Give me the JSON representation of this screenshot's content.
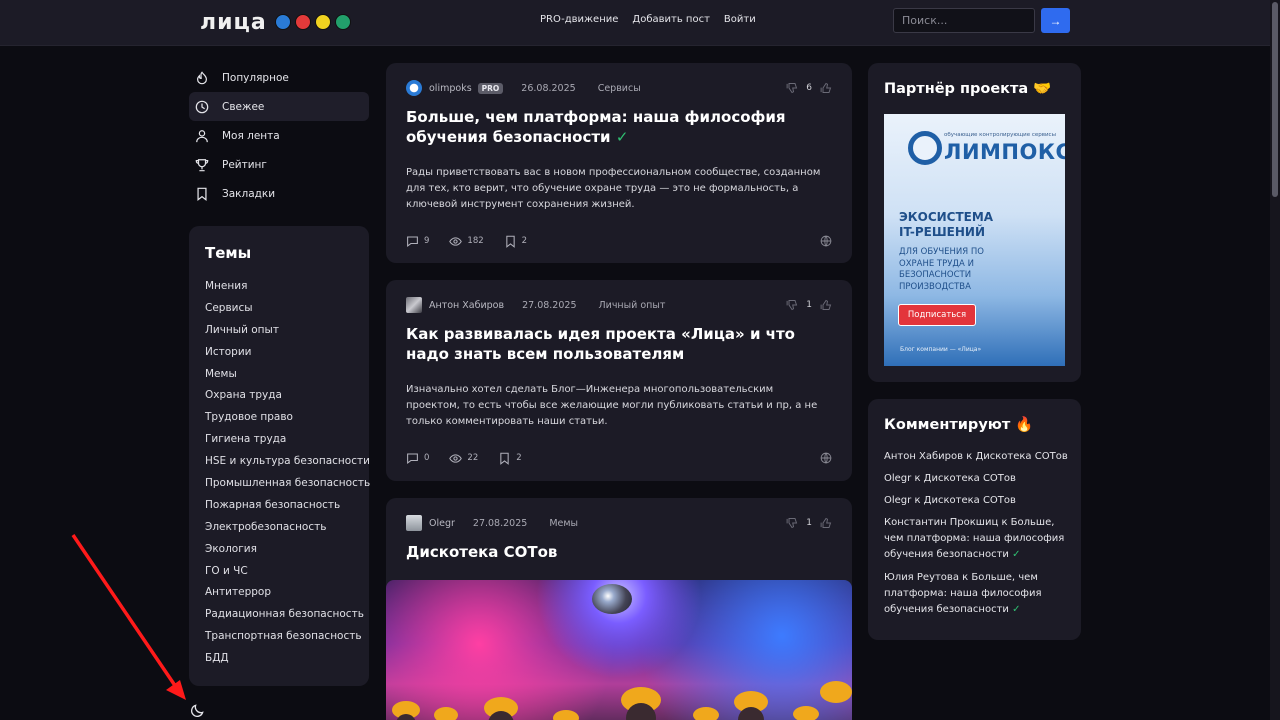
{
  "header": {
    "logo": "лица",
    "nav": [
      "PRO-движение",
      "Добавить пост",
      "Войти"
    ],
    "search_placeholder": "Поиск...",
    "search_button": "→"
  },
  "menu": [
    {
      "label": "Популярное",
      "icon": "fire-icon"
    },
    {
      "label": "Свежее",
      "icon": "clock-icon"
    },
    {
      "label": "Моя лента",
      "icon": "user-icon"
    },
    {
      "label": "Рейтинг",
      "icon": "trophy-icon"
    },
    {
      "label": "Закладки",
      "icon": "bookmark-icon"
    }
  ],
  "topics": {
    "title": "Темы",
    "items": [
      "Мнения",
      "Сервисы",
      "Личный опыт",
      "Истории",
      "Мемы",
      "Охрана труда",
      "Трудовое право",
      "Гигиена труда",
      "HSE и культура безопасности",
      "Промышленная безопасность",
      "Пожарная безопасность",
      "Электробезопасность",
      "Экология",
      "ГО и ЧС",
      "Антитеррор",
      "Радиационная безопасность",
      "Транспортная безопасность",
      "БДД"
    ]
  },
  "posts": [
    {
      "author": "olimpoks",
      "badge": "PRO",
      "date": "26.08.2025",
      "category": "Сервисы",
      "votes": "6",
      "title": "Больше, чем платформа: наша философия обучения безопасности",
      "verified": "✓",
      "text": "Рады приветствовать вас в новом профессиональном сообществе, созданном для тех, кто верит, что обучение охране труда — это не формальность, а ключевой инструмент сохранения жизней.",
      "comments": "9",
      "views": "182",
      "bookmarks": "2"
    },
    {
      "author": "Антон Хабиров",
      "date": "27.08.2025",
      "category": "Личный опыт",
      "votes": "1",
      "title": "Как развивалась идея проекта «Лица» и что надо знать всем пользователям",
      "text": "Изначально хотел сделать Блог—Инженера многопользовательским проектом, то есть чтобы все желающие могли публиковать статьи и пр, а не только комментировать наши статьи.",
      "comments": "0",
      "views": "22",
      "bookmarks": "2"
    },
    {
      "author": "Olegr",
      "date": "27.08.2025",
      "category": "Мемы",
      "votes": "1",
      "title": "Дискотека СОТов"
    }
  ],
  "partner": {
    "title": "Партнёр проекта 🤝",
    "banner_small": "обучающие контролирующие сервисы",
    "banner_brand": "ЛИМПОКС",
    "banner_h1": "ЭКОСИСТЕМА IT-РЕШЕНИЙ",
    "banner_h2": "ДЛЯ ОБУЧЕНИЯ ПО ОХРАНЕ ТРУДА И БЕЗОПАСНОСТИ ПРОИЗВОДСТВА",
    "banner_button": "Подписаться",
    "banner_footer": "Блог компании — «Лица»"
  },
  "comments": {
    "title": "Комментируют 🔥",
    "items": [
      "Антон Хабиров к Дискотека СОТов",
      "Olegr к Дискотека СОТов",
      "Olegr к Дискотека СОТов",
      "Константин Прокшиц к Больше, чем платформа: наша философия обучения безопасности",
      "Юлия Реутова к Больше, чем платформа: наша философия обучения безопасности"
    ],
    "check": "✓"
  },
  "colors": {
    "accent": "#2f6bef",
    "card": "#1c1b26",
    "background": "#0c0c12",
    "check": "#2fbf71"
  }
}
